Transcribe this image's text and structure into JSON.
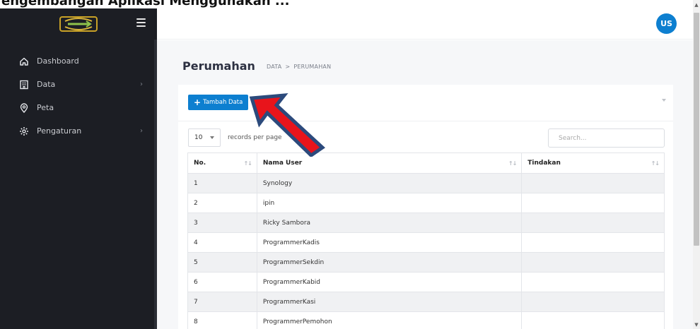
{
  "top": {
    "cut_title": "engembangan Aplikasi Menggunakan ..."
  },
  "header": {
    "avatar_initials": "US"
  },
  "sidebar": {
    "items": [
      {
        "label": "Dashboard",
        "icon": "home-icon",
        "has_children": false
      },
      {
        "label": "Data",
        "icon": "data-building-icon",
        "has_children": true
      },
      {
        "label": "Peta",
        "icon": "map-pin-icon",
        "has_children": false
      },
      {
        "label": "Pengaturan",
        "icon": "gear-icon",
        "has_children": true
      }
    ]
  },
  "page": {
    "title": "Perumahan",
    "breadcrumb": [
      "DATA",
      "PERUMAHAN"
    ],
    "breadcrumb_sep": ">"
  },
  "toolbar": {
    "add_label": "Tambah Data"
  },
  "table_controls": {
    "page_length": "10",
    "length_label": "records per page",
    "search_placeholder": "Search..."
  },
  "table": {
    "columns": [
      "No.",
      "Nama User",
      "Tindakan"
    ],
    "rows": [
      {
        "no": "1",
        "nama": "Synology",
        "tindakan": ""
      },
      {
        "no": "2",
        "nama": "ipin",
        "tindakan": ""
      },
      {
        "no": "3",
        "nama": "Ricky Sambora",
        "tindakan": ""
      },
      {
        "no": "4",
        "nama": "ProgrammerKadis",
        "tindakan": ""
      },
      {
        "no": "5",
        "nama": "ProgrammerSekdin",
        "tindakan": ""
      },
      {
        "no": "6",
        "nama": "ProgrammerKabid",
        "tindakan": ""
      },
      {
        "no": "7",
        "nama": "ProgrammerKasi",
        "tindakan": ""
      },
      {
        "no": "8",
        "nama": "ProgrammerPemohon",
        "tindakan": ""
      }
    ]
  },
  "colors": {
    "sidebar_bg": "#1c1e24",
    "accent": "#0d7fd0",
    "annotation_arrow": "#e8141b",
    "annotation_outline": "#2c4a7c"
  }
}
